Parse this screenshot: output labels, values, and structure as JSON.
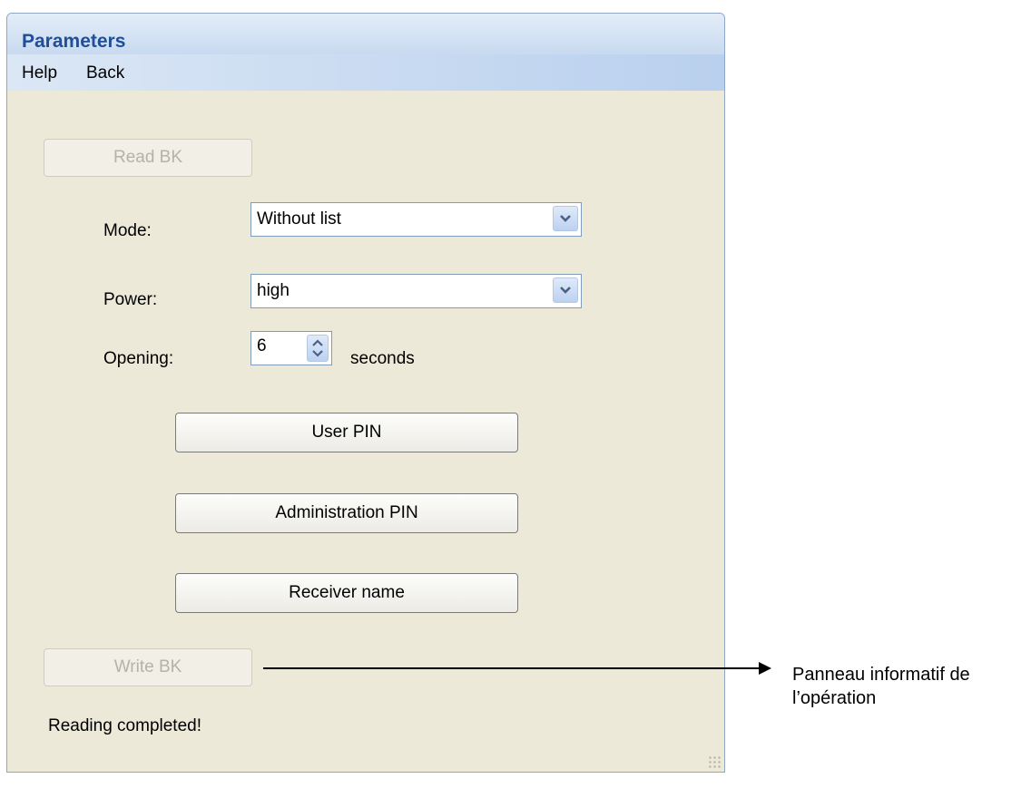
{
  "window": {
    "title": "Parameters"
  },
  "menu": {
    "help": "Help",
    "back": "Back"
  },
  "buttons": {
    "read_bk": "Read BK",
    "user_pin": "User PIN",
    "admin_pin": "Administration PIN",
    "receiver_name": "Receiver name",
    "write_bk": "Write BK"
  },
  "fields": {
    "mode": {
      "label": "Mode:",
      "value": "Without list"
    },
    "power": {
      "label": "Power:",
      "value": "high"
    },
    "opening": {
      "label": "Opening:",
      "value": "6",
      "unit": "seconds"
    }
  },
  "status": {
    "text": "Reading completed!"
  },
  "annotation": {
    "line1": "Panneau informatif de",
    "line2": "l’opération"
  },
  "icons": [
    "chevron-down-icon",
    "spin-up-down-icon",
    "resize-grip-icon"
  ]
}
